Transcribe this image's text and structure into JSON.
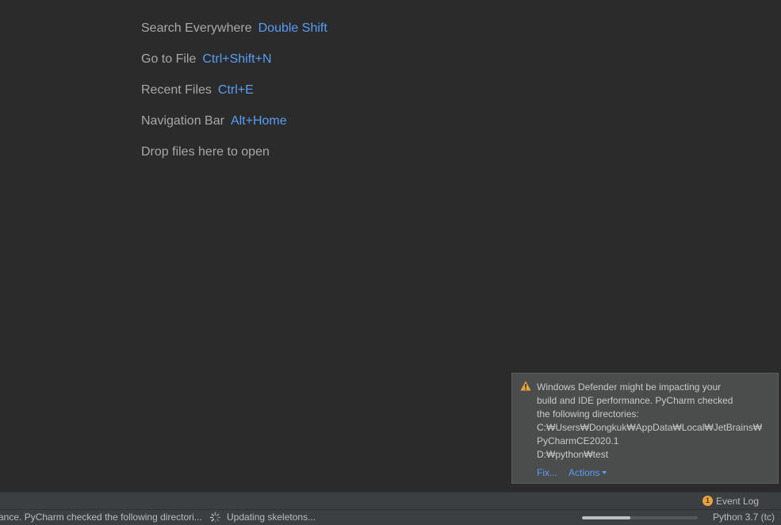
{
  "editor_hints": [
    {
      "label": "Search Everywhere",
      "shortcut": "Double Shift"
    },
    {
      "label": "Go to File",
      "shortcut": "Ctrl+Shift+N"
    },
    {
      "label": "Recent Files",
      "shortcut": "Ctrl+E"
    },
    {
      "label": "Navigation Bar",
      "shortcut": "Alt+Home"
    },
    {
      "label": "Drop files here to open",
      "shortcut": ""
    }
  ],
  "notification": {
    "icon": "warning-icon",
    "lines": [
      "Windows Defender might be impacting your",
      "build and IDE performance. PyCharm checked",
      "the following directories:",
      "C:₩Users₩Dongkuk₩AppData₩Local₩JetBrains₩",
      "PyCharmCE2020.1",
      "D:₩python₩test"
    ],
    "fix_link": "Fix...",
    "actions_link": "Actions"
  },
  "tool_window_bar": {
    "event_log_label": "Event Log",
    "event_log_badge": "1"
  },
  "status_bar": {
    "message": "ance. PyCharm checked the following directori...",
    "task": "Updating skeletons...",
    "progress": 0.42,
    "interpreter": "Python 3.7 (tc)"
  },
  "colors": {
    "background": "#2b2b2b",
    "hint_text": "#a8a8a8",
    "shortcut_text": "#589df6",
    "balloon_bg": "#4b4d4d",
    "warning": "#e8a33d",
    "status_bg": "#3c3f41"
  }
}
